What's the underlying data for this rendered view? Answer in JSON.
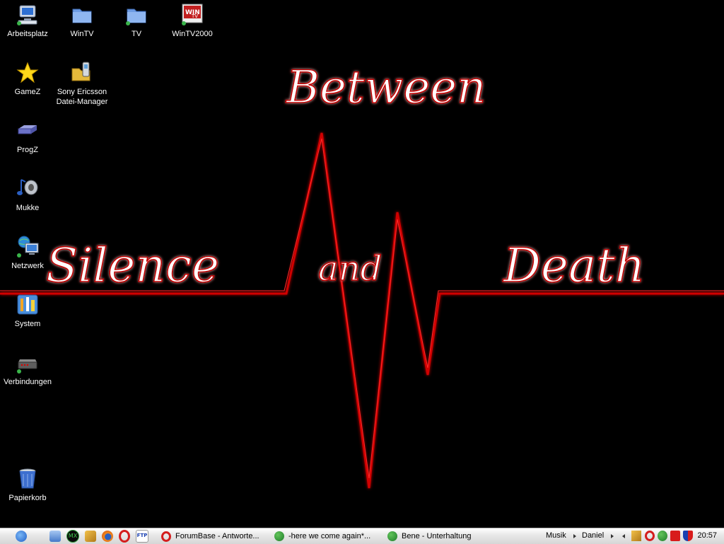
{
  "wallpaper": {
    "words": [
      "Between",
      "Silence",
      "and",
      "Death"
    ],
    "line_color": "#d00000",
    "background": "#000000"
  },
  "desktop_icons": [
    {
      "label": "Arbeitsplatz",
      "icon": "computer-icon"
    },
    {
      "label": "WinTV",
      "icon": "folder-icon"
    },
    {
      "label": "TV",
      "icon": "folder-icon"
    },
    {
      "label": "WinTV2000",
      "icon": "wintv-app-icon"
    },
    {
      "label": "GameZ",
      "icon": "star-icon"
    },
    {
      "label": "Sony Ericsson\nDatei-Manager",
      "icon": "phone-folder-icon"
    },
    {
      "label": "ProgZ",
      "icon": "drive-icon"
    },
    {
      "label": "Mukke",
      "icon": "music-icon"
    },
    {
      "label": "Netzwerk",
      "icon": "network-icon"
    },
    {
      "label": "System",
      "icon": "system-icon"
    },
    {
      "label": "Verbindungen",
      "icon": "connections-icon"
    },
    {
      "label": "Papierkorb",
      "icon": "recycle-bin-icon"
    }
  ],
  "taskbar": {
    "quick_launch": [
      "apple-start-icon",
      "desktop-icon",
      "mx-icon",
      "tools-icon",
      "firefox-icon",
      "opera-icon",
      "ftp-icon"
    ],
    "tasks": [
      {
        "label": "ForumBase - Antworte...",
        "icon": "opera-icon"
      },
      {
        "label": "-here we come again*...",
        "icon": "messenger-icon"
      },
      {
        "label": "Bene - Unterhaltung",
        "icon": "messenger-icon"
      }
    ],
    "toolbars": [
      "Musik",
      "Daniel"
    ],
    "tray_icons": [
      "tools-icon",
      "opera-icon",
      "messenger-icon",
      "antivirus-icon",
      "shield-icon"
    ],
    "clock": "20:57"
  }
}
